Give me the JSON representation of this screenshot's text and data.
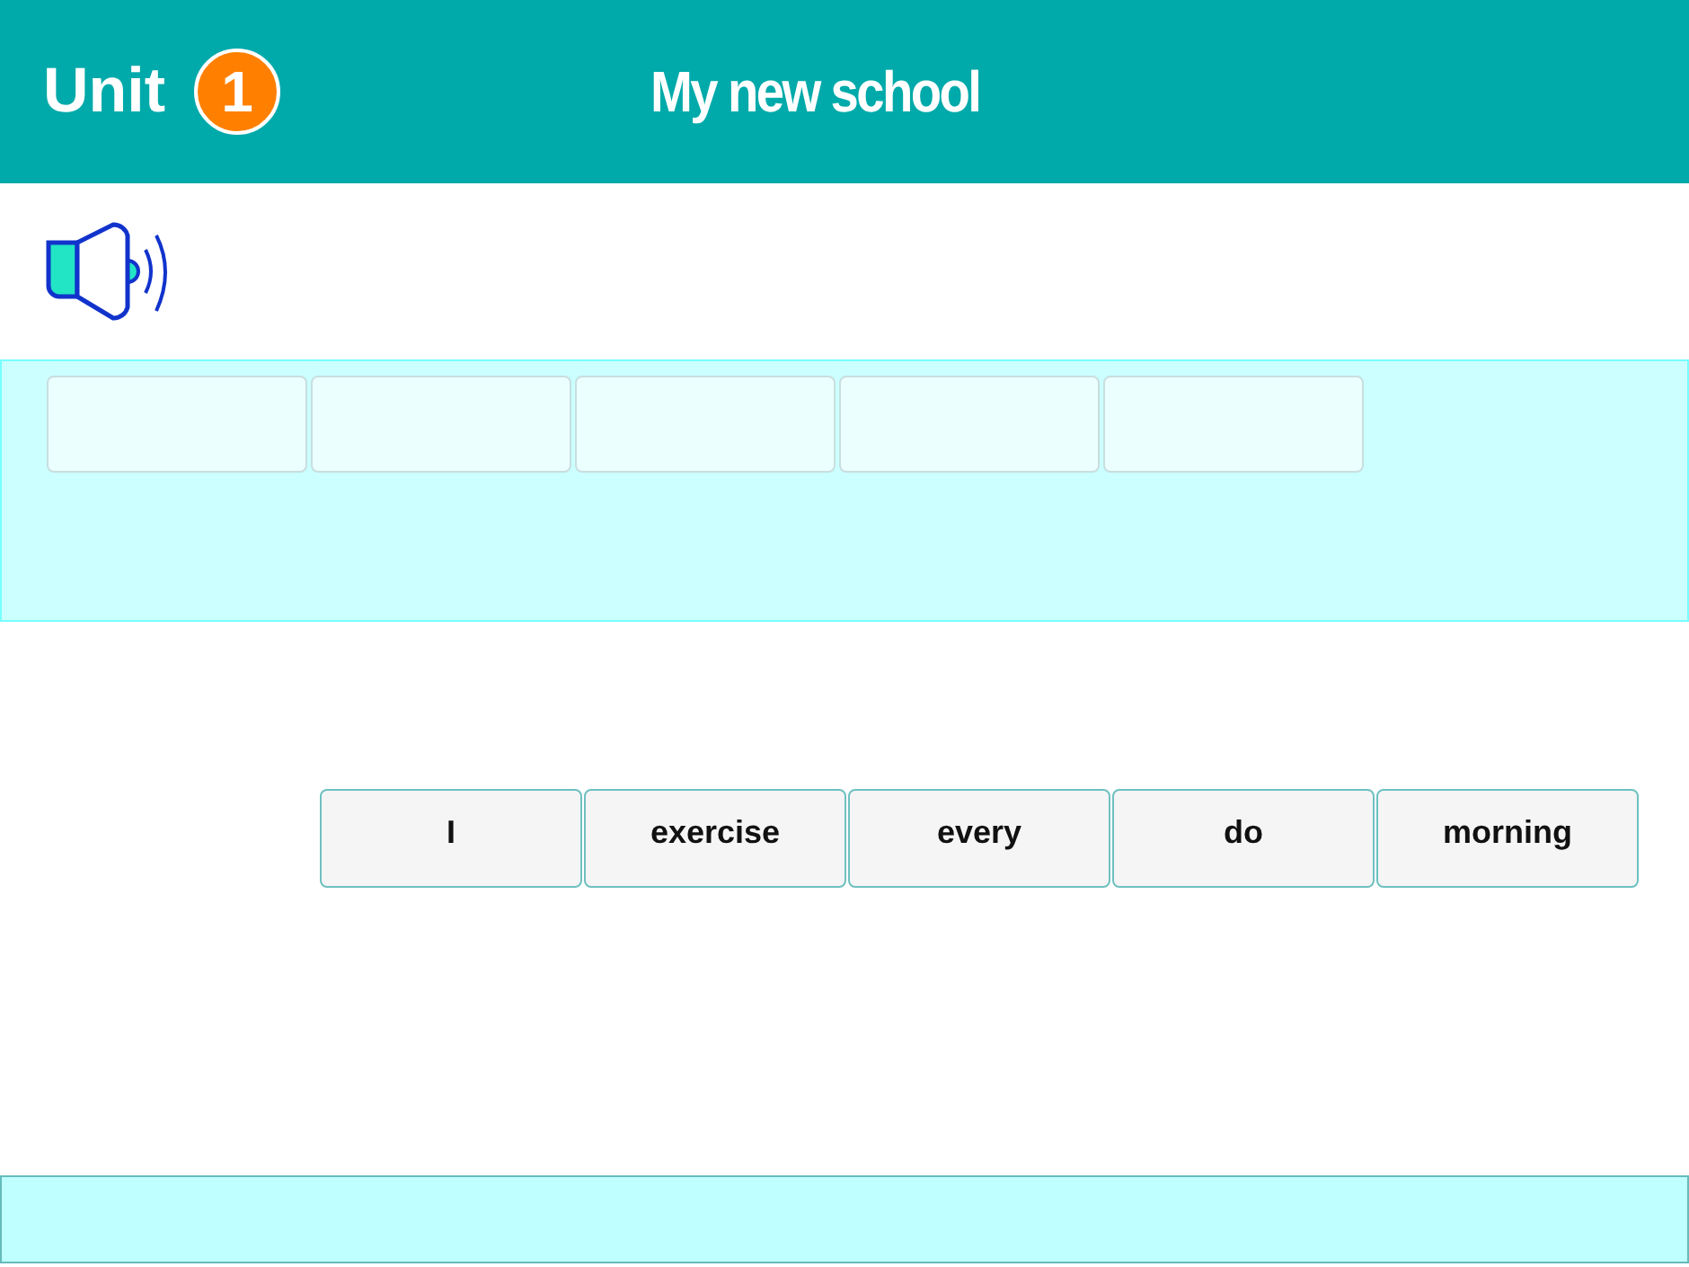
{
  "header": {
    "unit_label": "Unit",
    "unit_number": "1",
    "title": "My new school"
  },
  "answer_slots": [
    {
      "filled": false
    },
    {
      "filled": false
    },
    {
      "filled": false
    },
    {
      "filled": false
    },
    {
      "filled": false
    }
  ],
  "word_tiles": [
    {
      "word": "I"
    },
    {
      "word": "exercise"
    },
    {
      "word": "every"
    },
    {
      "word": "do"
    },
    {
      "word": "morning"
    }
  ]
}
